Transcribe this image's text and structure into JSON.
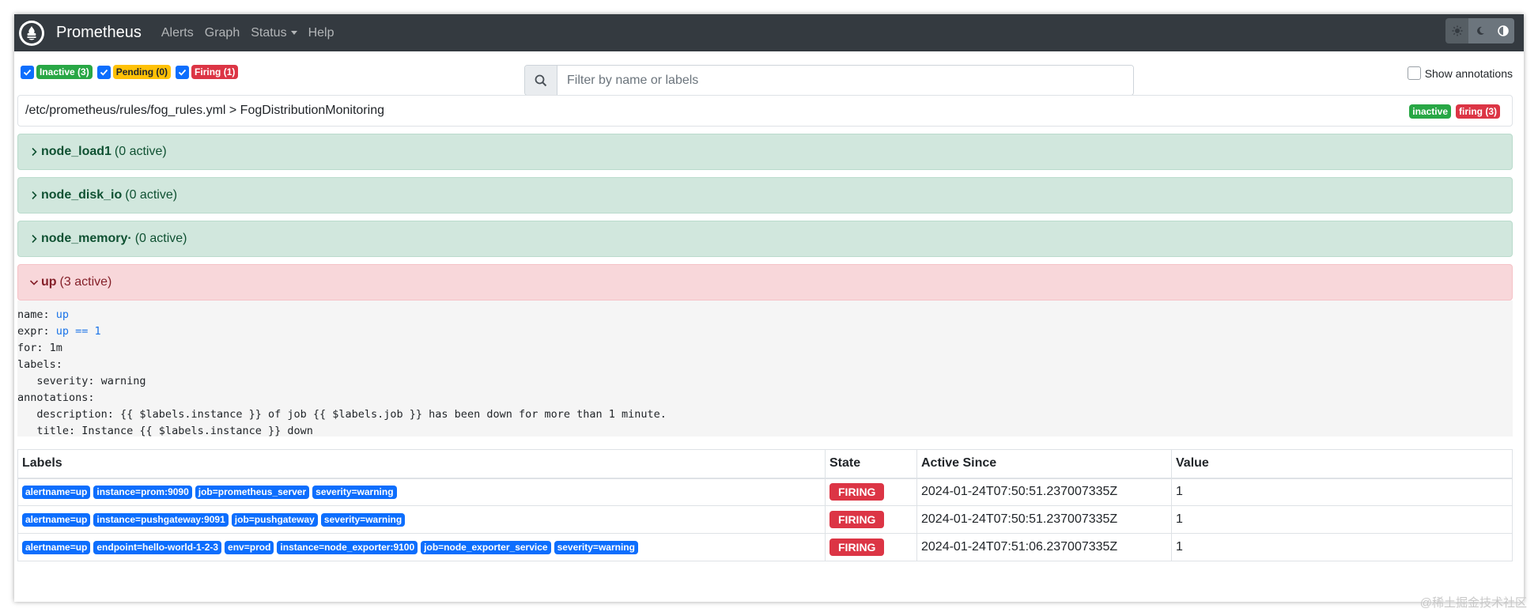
{
  "nav": {
    "brand": "Prometheus",
    "links": [
      "Alerts",
      "Graph",
      "Status",
      "Help"
    ]
  },
  "filters": {
    "states": [
      {
        "label": "Inactive (3)",
        "checked": true,
        "color": "#28a745"
      },
      {
        "label": "Pending (0)",
        "checked": true,
        "color": "#ffc107"
      },
      {
        "label": "Firing (1)",
        "checked": true,
        "color": "#dc3545"
      }
    ],
    "search_placeholder": "Filter by name or labels",
    "show_annotations": "Show annotations"
  },
  "file": {
    "path": "/etc/prometheus/rules/fog_rules.yml > FogDistributionMonitoring",
    "badge_inactive": "inactive",
    "badge_firing": "firing (3)"
  },
  "rules": [
    {
      "name": "node_load1",
      "status": "(0 active)",
      "state": "inactive",
      "expanded": false
    },
    {
      "name": "node_disk_io",
      "status": "(0 active)",
      "state": "inactive",
      "expanded": false
    },
    {
      "name": "node_memory·",
      "status": "(0 active)",
      "state": "inactive",
      "expanded": false
    },
    {
      "name": "up",
      "status": "(3 active)",
      "state": "firing",
      "expanded": true
    }
  ],
  "rule_def": {
    "name_key": "name: ",
    "name_val": "up",
    "expr_key": "expr: ",
    "expr_val": "up == 1",
    "for_line": "for: 1m",
    "labels_key": "labels:",
    "severity_line": "   severity: warning",
    "annotations_key": "annotations:",
    "description_line": "   description: {{ $labels.instance }} of job {{ $labels.job }} has been down for more than 1 minute.",
    "title_line": "   title: Instance {{ $labels.instance }} down"
  },
  "table": {
    "headers": [
      "Labels",
      "State",
      "Active Since",
      "Value"
    ],
    "rows": [
      {
        "labels": [
          "alertname=up",
          "instance=prom:9090",
          "job=prometheus_server",
          "severity=warning"
        ],
        "state": "FIRING",
        "since": "2024-01-24T07:50:51.237007335Z",
        "value": "1"
      },
      {
        "labels": [
          "alertname=up",
          "instance=pushgateway:9091",
          "job=pushgateway",
          "severity=warning"
        ],
        "state": "FIRING",
        "since": "2024-01-24T07:50:51.237007335Z",
        "value": "1"
      },
      {
        "labels": [
          "alertname=up",
          "endpoint=hello-world-1-2-3",
          "env=prod",
          "instance=node_exporter:9100",
          "job=node_exporter_service",
          "severity=warning"
        ],
        "state": "FIRING",
        "since": "2024-01-24T07:51:06.237007335Z",
        "value": "1"
      }
    ]
  },
  "watermark": "@稀土掘金技术社区",
  "colors": {
    "navbar": "#343a40",
    "inactive_bg": "#d1e7dd",
    "firing_bg": "#f8d7da",
    "label_blue": "#0d6efd",
    "firing_red": "#dc3545"
  }
}
